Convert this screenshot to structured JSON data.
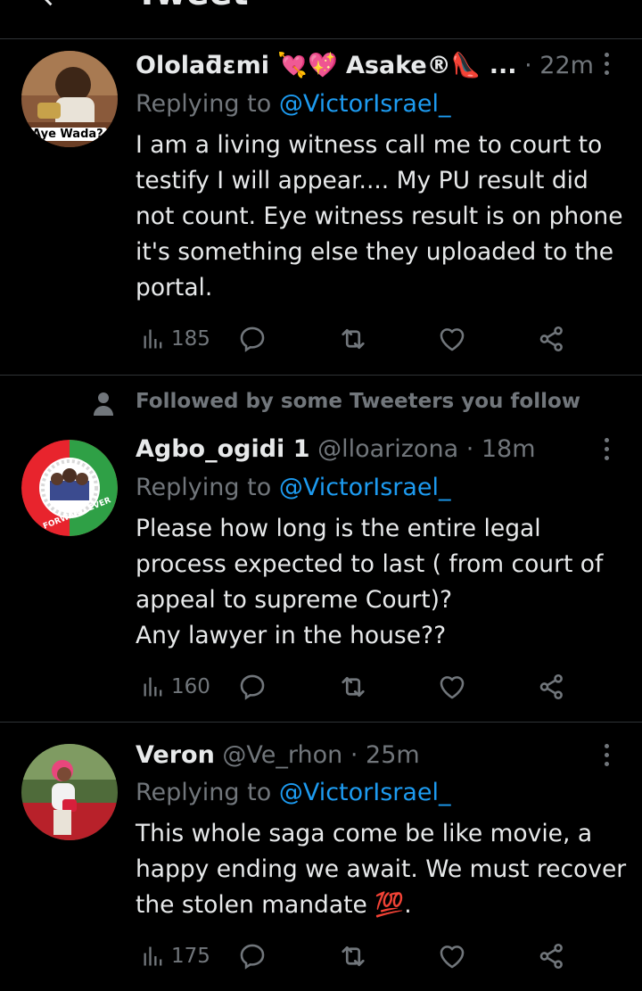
{
  "header": {
    "back_icon": "arrow-left-icon",
    "title": "Tweet"
  },
  "tweets": [
    {
      "author_name": "Ololaƌɛmi 💘💖 Asake®👠 ...",
      "handle": "",
      "time": "· 22m",
      "replying_label": "Replying to",
      "replying_to": "@VictorIsrael_",
      "text": "I am a living witness call me to court to testify I will appear.... My PU result did not count. Eye witness result is on phone it's something else they uploaded to the portal.",
      "views": "185",
      "avatar_caption": "Aye Wada?"
    },
    {
      "social_context": "Followed by some Tweeters you follow",
      "author_name": "Agbo_ogidi 1",
      "handle": "@lloarizona",
      "time": "· 18m",
      "replying_label": "Replying to",
      "replying_to": "@VictorIsrael_",
      "text": "Please how long is the entire legal process expected to last ( from court of appeal to supreme Court)?\nAny lawyer in the house??",
      "views": "160",
      "avatar_caption": "FORWARD EVER"
    },
    {
      "author_name": "Veron",
      "handle": "@Ve_rhon",
      "time": "· 25m",
      "replying_label": "Replying to",
      "replying_to": "@VictorIsrael_",
      "text": "This whole saga come be like movie, a happy ending we await. We must recover the stolen mandate 💯.",
      "views": "175"
    }
  ],
  "colors": {
    "background": "#000000",
    "text": "#e7e9ea",
    "muted": "#71767b",
    "link": "#1d9bf0",
    "divider": "#2f3336"
  }
}
